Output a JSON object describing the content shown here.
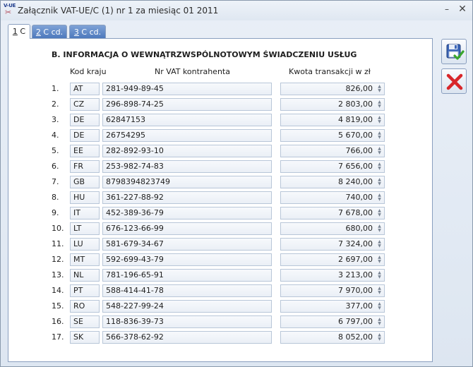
{
  "window": {
    "title": "Załącznik VAT-UE/C (1) nr 1 za miesiąc 01 2011",
    "icon_text": "V-UE",
    "controls": {
      "minimize": "–",
      "close": "✕"
    }
  },
  "tabs": [
    {
      "accel": "1",
      "rest": " C"
    },
    {
      "accel": "2",
      "rest": " C cd."
    },
    {
      "accel": "3",
      "rest": " C cd."
    }
  ],
  "section_title": "B. INFORMACJA O WEWNĄTRZWSPÓLNOTOWYM ŚWIADCZENIU USŁUG",
  "columns": {
    "kod": "Kod kraju",
    "vat": "Nr VAT kontrahenta",
    "kwota": "Kwota transakcji w zł"
  },
  "rows": [
    {
      "num": "1.",
      "code": "AT",
      "vat": "281-949-89-45",
      "amount": "826,00"
    },
    {
      "num": "2.",
      "code": "CZ",
      "vat": "296-898-74-25",
      "amount": "2 803,00"
    },
    {
      "num": "3.",
      "code": "DE",
      "vat": "62847153",
      "amount": "4 819,00"
    },
    {
      "num": "4.",
      "code": "DE",
      "vat": "26754295",
      "amount": "5 670,00"
    },
    {
      "num": "5.",
      "code": "EE",
      "vat": "282-892-93-10",
      "amount": "766,00"
    },
    {
      "num": "6.",
      "code": "FR",
      "vat": "253-982-74-83",
      "amount": "7 656,00"
    },
    {
      "num": "7.",
      "code": "GB",
      "vat": "8798394823749",
      "amount": "8 240,00"
    },
    {
      "num": "8.",
      "code": "HU",
      "vat": "361-227-88-92",
      "amount": "740,00"
    },
    {
      "num": "9.",
      "code": "IT",
      "vat": "452-389-36-79",
      "amount": "7 678,00"
    },
    {
      "num": "10.",
      "code": "LT",
      "vat": "676-123-66-99",
      "amount": "680,00"
    },
    {
      "num": "11.",
      "code": "LU",
      "vat": "581-679-34-67",
      "amount": "7 324,00"
    },
    {
      "num": "12.",
      "code": "MT",
      "vat": "592-699-43-79",
      "amount": "2 697,00"
    },
    {
      "num": "13.",
      "code": "NL",
      "vat": "781-196-65-91",
      "amount": "3 213,00"
    },
    {
      "num": "14.",
      "code": "PT",
      "vat": "588-414-41-78",
      "amount": "7 970,00"
    },
    {
      "num": "15.",
      "code": "RO",
      "vat": "548-227-99-24",
      "amount": "377,00"
    },
    {
      "num": "16.",
      "code": "SE",
      "vat": "118-836-39-73",
      "amount": "6 797,00"
    },
    {
      "num": "17.",
      "code": "SK",
      "vat": "566-378-62-92",
      "amount": "8 052,00"
    }
  ],
  "icons": {
    "save": "save-icon",
    "cancel": "cancel-icon"
  },
  "colors": {
    "tab_inactive": "#4d79bd",
    "cancel_red": "#d8262a",
    "check_green": "#3aa62e"
  }
}
